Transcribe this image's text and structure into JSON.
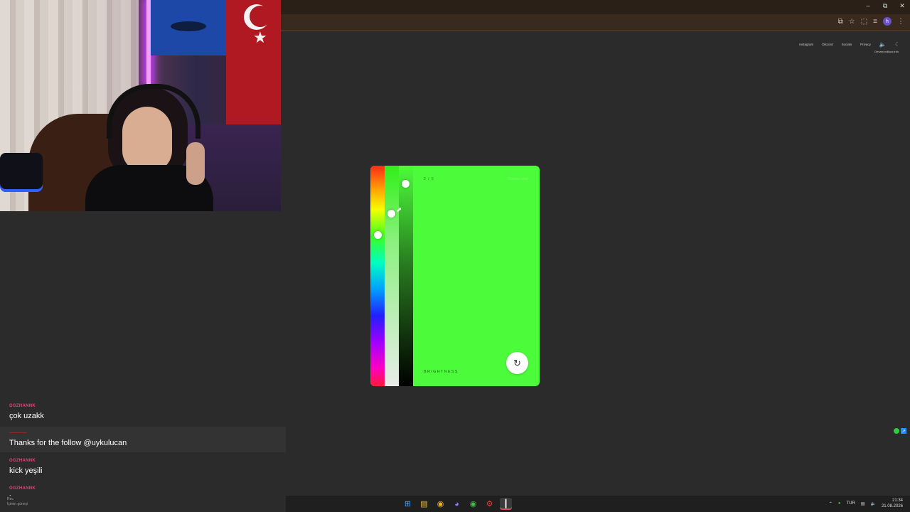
{
  "window": {
    "controls": [
      "–",
      "⧉",
      "✕"
    ]
  },
  "toolbar": {
    "profile_initial": "h",
    "icons": [
      "⧉",
      "☆",
      "⬚",
      "≡",
      "⋮"
    ]
  },
  "site_nav": {
    "links": [
      "Instagram",
      "Discord",
      "Socials",
      "Privacy"
    ],
    "sublink": "Devam ediliyor.info"
  },
  "chat": {
    "messages": [
      {
        "user": "OGZHANNK",
        "text": "çok uzakk"
      },
      {
        "user": "————",
        "text": "Thanks for the follow @uykulucan"
      },
      {
        "user": "OGZHANNK",
        "text": "kick yeşili"
      },
      {
        "user": "OGZHANNK",
        "text": "bu"
      }
    ],
    "overlay": [
      "Rec",
      "İçimin güneşi"
    ]
  },
  "card": {
    "step": "2 / 5",
    "corner_label": "Choose color",
    "brightness_label": "BRIGHTNESS",
    "color": "#4cfc3a",
    "refresh_glyph": "↻"
  },
  "taskbar": {
    "apps": [
      {
        "name": "start-icon",
        "glyph": "⊞",
        "color": "#3aa0ff"
      },
      {
        "name": "file-explorer-icon",
        "glyph": "▤",
        "color": "#f0c040"
      },
      {
        "name": "chrome-icon",
        "glyph": "◉",
        "color": "#f0b020"
      },
      {
        "name": "discord-icon",
        "glyph": "◕",
        "color": "#8a7cff"
      },
      {
        "name": "chrome-alt-icon",
        "glyph": "◉",
        "color": "#40c040"
      },
      {
        "name": "settings-icon",
        "glyph": "⚙",
        "color": "#e04040"
      },
      {
        "name": "streaming-app-icon",
        "glyph": "┃",
        "color": "#ffffff"
      }
    ],
    "tray": {
      "lang": "TUR",
      "time": "21:34",
      "date": "21.08.2026"
    }
  }
}
